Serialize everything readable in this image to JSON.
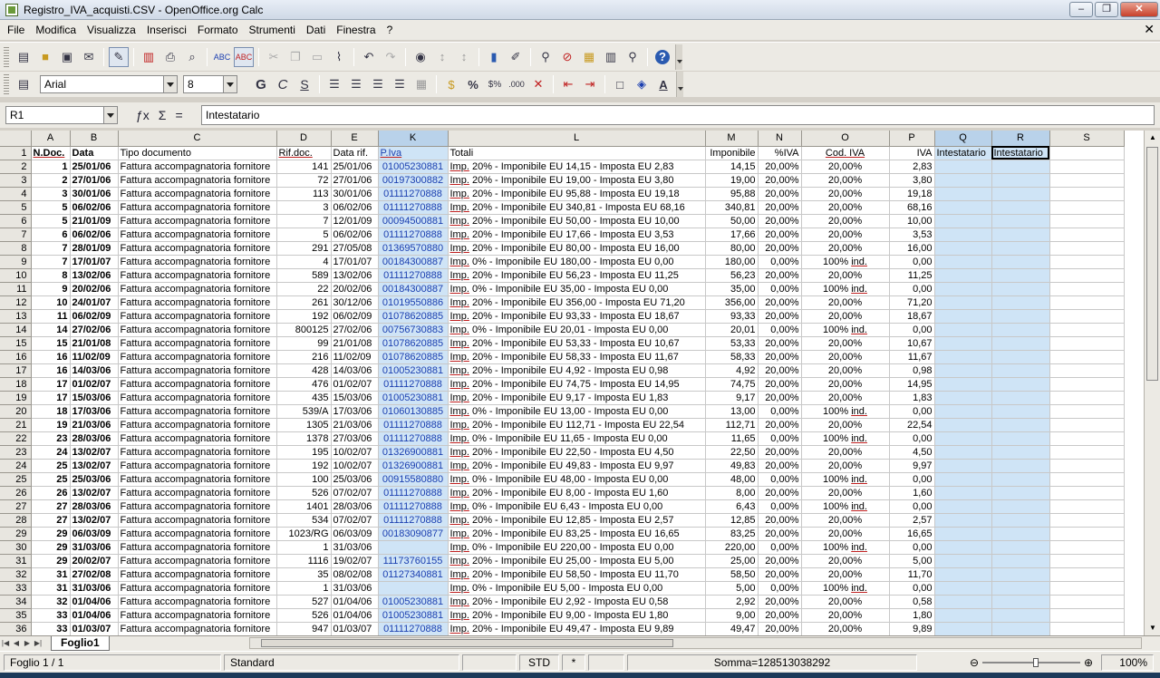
{
  "window": {
    "title": "Registro_IVA_acquisti.CSV - OpenOffice.org Calc",
    "min": "‒",
    "max": "❐",
    "close": "✕"
  },
  "menu": [
    "File",
    "Modifica",
    "Visualizza",
    "Inserisci",
    "Formato",
    "Strumenti",
    "Dati",
    "Finestra",
    "?"
  ],
  "formatting": {
    "font": "Arial",
    "size": "8",
    "bold": "G",
    "italic": "C",
    "underline": "S"
  },
  "formula": {
    "cellref": "R1",
    "content": "Intestatario"
  },
  "columns": [
    "A",
    "B",
    "C",
    "D",
    "E",
    "K",
    "L",
    "M",
    "N",
    "O",
    "P",
    "Q",
    "R",
    "S"
  ],
  "header_row": [
    "N.Doc.",
    "Data",
    "Tipo documento",
    "Rif.doc.",
    "Data rif.",
    "P.Iva",
    "Totali",
    "Imponibile",
    "%IVA",
    "Cod. IVA",
    "IVA",
    "Intestatario",
    "Intestatario",
    ""
  ],
  "rows": [
    [
      "1",
      "25/01/06",
      "Fattura accompagnatoria fornitore",
      "141",
      "25/01/06",
      "01005230881",
      "Imp. 20% - Imponibile EU 14,15 - Imposta EU 2,83",
      "14,15",
      "20,00%",
      "20,00%",
      "2,83"
    ],
    [
      "2",
      "27/01/06",
      "Fattura accompagnatoria fornitore",
      "72",
      "27/01/06",
      "00197300882",
      "Imp. 20% - Imponibile EU 19,00 - Imposta EU 3,80",
      "19,00",
      "20,00%",
      "20,00%",
      "3,80"
    ],
    [
      "3",
      "30/01/06",
      "Fattura accompagnatoria fornitore",
      "113",
      "30/01/06",
      "01111270888",
      "Imp. 20% - Imponibile EU 95,88 - Imposta EU 19,18",
      "95,88",
      "20,00%",
      "20,00%",
      "19,18"
    ],
    [
      "5",
      "06/02/06",
      "Fattura accompagnatoria fornitore",
      "3",
      "06/02/06",
      "01111270888",
      "Imp. 20% - Imponibile EU 340,81 - Imposta EU 68,16",
      "340,81",
      "20,00%",
      "20,00%",
      "68,16"
    ],
    [
      "5",
      "21/01/09",
      "Fattura accompagnatoria fornitore",
      "7",
      "12/01/09",
      "00094500881",
      "Imp. 20% - Imponibile EU 50,00 - Imposta EU 10,00",
      "50,00",
      "20,00%",
      "20,00%",
      "10,00"
    ],
    [
      "6",
      "06/02/06",
      "Fattura accompagnatoria fornitore",
      "5",
      "06/02/06",
      "01111270888",
      "Imp. 20% - Imponibile EU 17,66 - Imposta EU 3,53",
      "17,66",
      "20,00%",
      "20,00%",
      "3,53"
    ],
    [
      "7",
      "28/01/09",
      "Fattura accompagnatoria fornitore",
      "291",
      "27/05/08",
      "01369570880",
      "Imp. 20% - Imponibile EU 80,00 - Imposta EU 16,00",
      "80,00",
      "20,00%",
      "20,00%",
      "16,00"
    ],
    [
      "7",
      "17/01/07",
      "Fattura accompagnatoria fornitore",
      "4",
      "17/01/07",
      "00184300887",
      "Imp. 0% - Imponibile EU 180,00 - Imposta EU 0,00",
      "180,00",
      "0,00%",
      "100% ind.",
      "0,00"
    ],
    [
      "8",
      "13/02/06",
      "Fattura accompagnatoria fornitore",
      "589",
      "13/02/06",
      "01111270888",
      "Imp. 20% - Imponibile EU 56,23 - Imposta EU 11,25",
      "56,23",
      "20,00%",
      "20,00%",
      "11,25"
    ],
    [
      "9",
      "20/02/06",
      "Fattura accompagnatoria fornitore",
      "22",
      "20/02/06",
      "00184300887",
      "Imp. 0% - Imponibile EU 35,00 - Imposta EU 0,00",
      "35,00",
      "0,00%",
      "100% ind.",
      "0,00"
    ],
    [
      "10",
      "24/01/07",
      "Fattura accompagnatoria fornitore",
      "261",
      "30/12/06",
      "01019550886",
      "Imp. 20% - Imponibile EU 356,00 - Imposta EU 71,20",
      "356,00",
      "20,00%",
      "20,00%",
      "71,20"
    ],
    [
      "11",
      "06/02/09",
      "Fattura accompagnatoria fornitore",
      "192",
      "06/02/09",
      "01078620885",
      "Imp. 20% - Imponibile EU 93,33 - Imposta EU 18,67",
      "93,33",
      "20,00%",
      "20,00%",
      "18,67"
    ],
    [
      "14",
      "27/02/06",
      "Fattura accompagnatoria fornitore",
      "800125",
      "27/02/06",
      "00756730883",
      "Imp. 0% - Imponibile EU 20,01 - Imposta EU 0,00",
      "20,01",
      "0,00%",
      "100% ind.",
      "0,00"
    ],
    [
      "15",
      "21/01/08",
      "Fattura accompagnatoria fornitore",
      "99",
      "21/01/08",
      "01078620885",
      "Imp. 20% - Imponibile EU 53,33 - Imposta EU 10,67",
      "53,33",
      "20,00%",
      "20,00%",
      "10,67"
    ],
    [
      "16",
      "11/02/09",
      "Fattura accompagnatoria fornitore",
      "216",
      "11/02/09",
      "01078620885",
      "Imp. 20% - Imponibile EU 58,33 - Imposta EU 11,67",
      "58,33",
      "20,00%",
      "20,00%",
      "11,67"
    ],
    [
      "16",
      "14/03/06",
      "Fattura accompagnatoria fornitore",
      "428",
      "14/03/06",
      "01005230881",
      "Imp. 20% - Imponibile EU 4,92 - Imposta EU 0,98",
      "4,92",
      "20,00%",
      "20,00%",
      "0,98"
    ],
    [
      "17",
      "01/02/07",
      "Fattura accompagnatoria fornitore",
      "476",
      "01/02/07",
      "01111270888",
      "Imp. 20% - Imponibile EU 74,75 - Imposta EU 14,95",
      "74,75",
      "20,00%",
      "20,00%",
      "14,95"
    ],
    [
      "17",
      "15/03/06",
      "Fattura accompagnatoria fornitore",
      "435",
      "15/03/06",
      "01005230881",
      "Imp. 20% - Imponibile EU 9,17 - Imposta EU 1,83",
      "9,17",
      "20,00%",
      "20,00%",
      "1,83"
    ],
    [
      "18",
      "17/03/06",
      "Fattura accompagnatoria fornitore",
      "539/A",
      "17/03/06",
      "01060130885",
      "Imp. 0% - Imponibile EU 13,00 - Imposta EU 0,00",
      "13,00",
      "0,00%",
      "100% ind.",
      "0,00"
    ],
    [
      "19",
      "21/03/06",
      "Fattura accompagnatoria fornitore",
      "1305",
      "21/03/06",
      "01111270888",
      "Imp. 20% - Imponibile EU 112,71 - Imposta EU 22,54",
      "112,71",
      "20,00%",
      "20,00%",
      "22,54"
    ],
    [
      "23",
      "28/03/06",
      "Fattura accompagnatoria fornitore",
      "1378",
      "27/03/06",
      "01111270888",
      "Imp. 0% - Imponibile EU 11,65 - Imposta EU 0,00",
      "11,65",
      "0,00%",
      "100% ind.",
      "0,00"
    ],
    [
      "24",
      "13/02/07",
      "Fattura accompagnatoria fornitore",
      "195",
      "10/02/07",
      "01326900881",
      "Imp. 20% - Imponibile EU 22,50 - Imposta EU 4,50",
      "22,50",
      "20,00%",
      "20,00%",
      "4,50"
    ],
    [
      "25",
      "13/02/07",
      "Fattura accompagnatoria fornitore",
      "192",
      "10/02/07",
      "01326900881",
      "Imp. 20% - Imponibile EU 49,83 - Imposta EU 9,97",
      "49,83",
      "20,00%",
      "20,00%",
      "9,97"
    ],
    [
      "25",
      "25/03/06",
      "Fattura accompagnatoria fornitore",
      "100",
      "25/03/06",
      "00915580880",
      "Imp. 0% - Imponibile EU 48,00 - Imposta EU 0,00",
      "48,00",
      "0,00%",
      "100% ind.",
      "0,00"
    ],
    [
      "26",
      "13/02/07",
      "Fattura accompagnatoria fornitore",
      "526",
      "07/02/07",
      "01111270888",
      "Imp. 20% - Imponibile EU 8,00 - Imposta EU 1,60",
      "8,00",
      "20,00%",
      "20,00%",
      "1,60"
    ],
    [
      "27",
      "28/03/06",
      "Fattura accompagnatoria fornitore",
      "1401",
      "28/03/06",
      "01111270888",
      "Imp. 0% - Imponibile EU 6,43 - Imposta EU 0,00",
      "6,43",
      "0,00%",
      "100% ind.",
      "0,00"
    ],
    [
      "27",
      "13/02/07",
      "Fattura accompagnatoria fornitore",
      "534",
      "07/02/07",
      "01111270888",
      "Imp. 20% - Imponibile EU 12,85 - Imposta EU 2,57",
      "12,85",
      "20,00%",
      "20,00%",
      "2,57"
    ],
    [
      "29",
      "06/03/09",
      "Fattura accompagnatoria fornitore",
      "1023/RG",
      "06/03/09",
      "00183090877",
      "Imp. 20% - Imponibile EU 83,25 - Imposta EU 16,65",
      "83,25",
      "20,00%",
      "20,00%",
      "16,65"
    ],
    [
      "29",
      "31/03/06",
      "Fattura accompagnatoria fornitore",
      "1",
      "31/03/06",
      "",
      "Imp. 0% - Imponibile EU 220,00 - Imposta EU 0,00",
      "220,00",
      "0,00%",
      "100% ind.",
      "0,00"
    ],
    [
      "29",
      "20/02/07",
      "Fattura accompagnatoria fornitore",
      "1116",
      "19/02/07",
      "11173760155",
      "Imp. 20% - Imponibile EU 25,00 - Imposta EU 5,00",
      "25,00",
      "20,00%",
      "20,00%",
      "5,00"
    ],
    [
      "31",
      "27/02/08",
      "Fattura accompagnatoria fornitore",
      "35",
      "08/02/08",
      "01127340881",
      "Imp. 20% - Imponibile EU 58,50 - Imposta EU 11,70",
      "58,50",
      "20,00%",
      "20,00%",
      "11,70"
    ],
    [
      "31",
      "31/03/06",
      "Fattura accompagnatoria fornitore",
      "1",
      "31/03/06",
      "",
      "Imp. 0% - Imponibile EU 5,00 - Imposta EU 0,00",
      "5,00",
      "0,00%",
      "100% ind.",
      "0,00"
    ],
    [
      "32",
      "01/04/06",
      "Fattura accompagnatoria fornitore",
      "527",
      "01/04/06",
      "01005230881",
      "Imp. 20% - Imponibile EU 2,92 - Imposta EU 0,58",
      "2,92",
      "20,00%",
      "20,00%",
      "0,58"
    ],
    [
      "33",
      "01/04/06",
      "Fattura accompagnatoria fornitore",
      "526",
      "01/04/06",
      "01005230881",
      "Imp. 20% - Imponibile EU 9,00 - Imposta EU 1,80",
      "9,00",
      "20,00%",
      "20,00%",
      "1,80"
    ],
    [
      "33",
      "01/03/07",
      "Fattura accompagnatoria fornitore",
      "947",
      "01/03/07",
      "01111270888",
      "Imp. 20% - Imponibile EU 49,47 - Imposta EU 9,89",
      "49,47",
      "20,00%",
      "20,00%",
      "9,89"
    ]
  ],
  "sheet_tab": "Foglio1",
  "status": {
    "sheet": "Foglio 1 / 1",
    "style": "Standard",
    "mode": "STD",
    "modified": "*",
    "sum": "Somma=128513038292",
    "zoom": "100%"
  }
}
